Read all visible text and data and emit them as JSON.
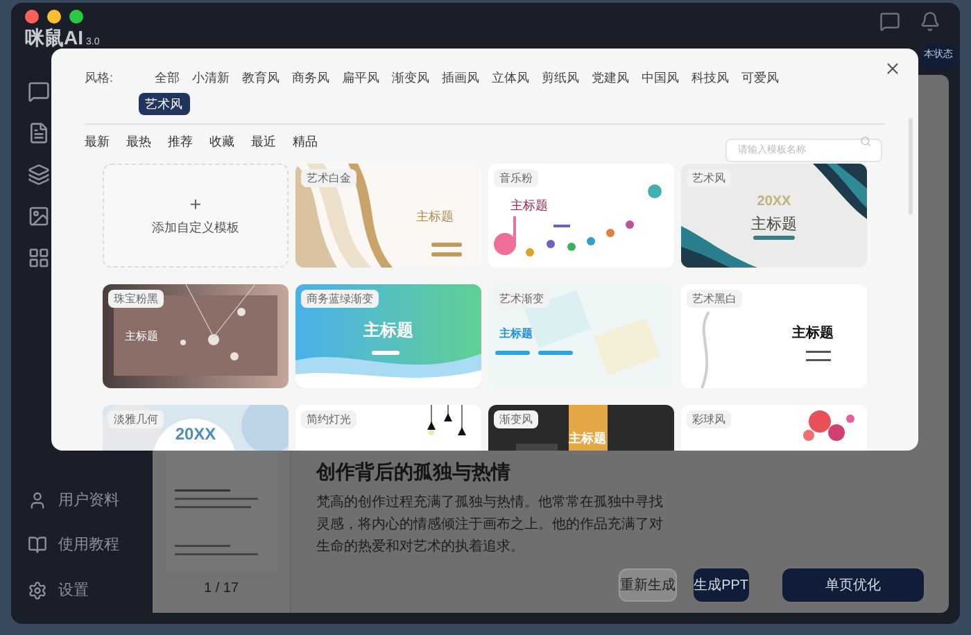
{
  "app": {
    "logo": "咪鼠AI",
    "logo_version": "3.0",
    "status_pill": "本状态",
    "nav": [
      {
        "label": "用户资料",
        "kind": "profile"
      },
      {
        "label": "使用教程",
        "kind": "guide"
      },
      {
        "label": "设置",
        "kind": "settings"
      }
    ],
    "article": {
      "heading": "创作背后的孤独与热情",
      "body": "梵高的创作过程充满了孤独与热情。他常常在孤独中寻找灵感，将内心的情感倾注于画布之上。他的作品充满了对生命的热爱和对艺术的执着追求。"
    },
    "page_indicator": "1 / 17",
    "buttons": [
      {
        "label": "重新生成",
        "kind": "secondary"
      },
      {
        "label": "生成PPT",
        "kind": "primary"
      },
      {
        "label": "单页优化",
        "kind": "wide"
      }
    ]
  },
  "modal": {
    "style_label": "风格:",
    "styles": [
      {
        "label": "全部",
        "selected": false
      },
      {
        "label": "小清新",
        "selected": false
      },
      {
        "label": "教育风",
        "selected": false
      },
      {
        "label": "商务风",
        "selected": false
      },
      {
        "label": "扁平风",
        "selected": false
      },
      {
        "label": "渐变风",
        "selected": false
      },
      {
        "label": "插画风",
        "selected": false
      },
      {
        "label": "立体风",
        "selected": false
      },
      {
        "label": "剪纸风",
        "selected": false
      },
      {
        "label": "党建风",
        "selected": false
      },
      {
        "label": "中国风",
        "selected": false
      },
      {
        "label": "科技风",
        "selected": false
      },
      {
        "label": "可爱风",
        "selected": false
      },
      {
        "label": "艺术风",
        "selected": true
      }
    ],
    "sort_tabs": [
      "最新",
      "最热",
      "推荐",
      "收藏",
      "最近",
      "精品"
    ],
    "search": {
      "placeholder": "请输入模板名称"
    },
    "add_template": {
      "icon": "+",
      "label": "添加自定义模板"
    },
    "templates": [
      {
        "kind": "marble",
        "label": "艺术白金",
        "title": "主标题"
      },
      {
        "kind": "music",
        "label": "音乐粉",
        "title": "主标题"
      },
      {
        "kind": "agate",
        "label": "艺术风",
        "year": "20XX",
        "title": "主标题"
      },
      {
        "kind": "jewel",
        "label": "珠宝粉黑",
        "title": "主标题"
      },
      {
        "kind": "wave",
        "label": "商务蓝绿渐变",
        "title": "主标题"
      },
      {
        "kind": "pastel",
        "label": "艺术渐变",
        "title": "主标题"
      },
      {
        "kind": "plain",
        "label": "艺术黑白",
        "title": "主标题"
      },
      {
        "kind": "geometric",
        "label": "淡雅几何",
        "year": "20XX"
      },
      {
        "kind": "light",
        "label": "简约灯光"
      },
      {
        "kind": "dark",
        "label": "渐变风",
        "title": "主标题"
      },
      {
        "kind": "ink",
        "label": "彩球风"
      }
    ]
  }
}
